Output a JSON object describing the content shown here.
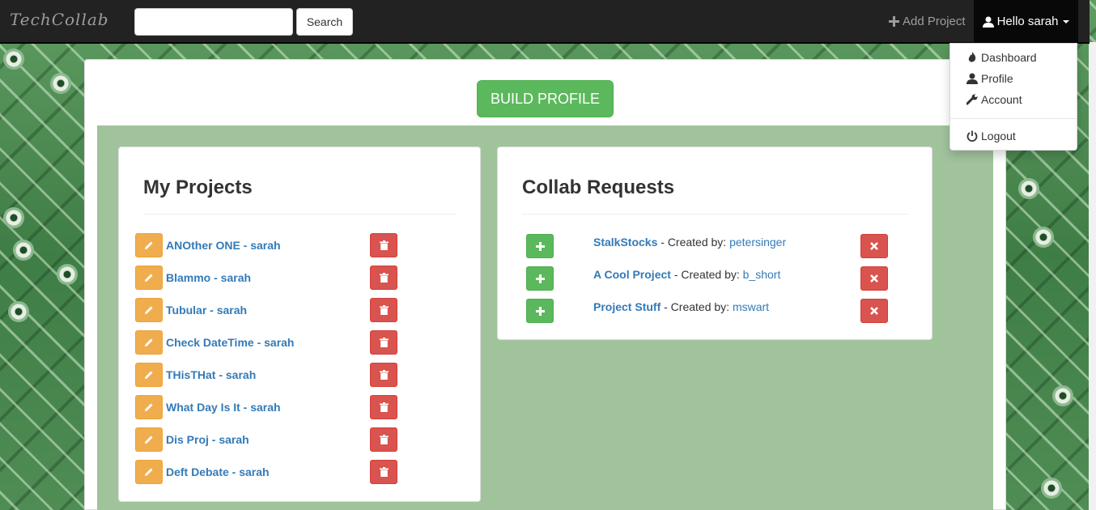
{
  "navbar": {
    "brand": "TechCollab",
    "search_placeholder": "",
    "search_button": "Search",
    "add_project": "Add Project",
    "user_greeting": "Hello sarah"
  },
  "user_menu": {
    "items": [
      {
        "label": "Dashboard",
        "icon": "fire-icon"
      },
      {
        "label": "Profile",
        "icon": "user-icon"
      },
      {
        "label": "Account",
        "icon": "wrench-icon"
      },
      {
        "label": "Logout",
        "icon": "power-icon"
      }
    ]
  },
  "main": {
    "build_profile": "BUILD PROFILE"
  },
  "my_projects": {
    "title": "My Projects",
    "items": [
      "ANOther ONE - sarah",
      "Blammo - sarah",
      "Tubular - sarah",
      "Check DateTime - sarah",
      "THisTHat - sarah",
      "What Day Is It - sarah",
      "Dis Proj - sarah",
      "Deft Debate - sarah"
    ]
  },
  "collab_requests": {
    "title": "Collab Requests",
    "created_by_label": " - Created by: ",
    "items": [
      {
        "project": "StalkStocks",
        "creator": "petersinger"
      },
      {
        "project": "A Cool Project",
        "creator": "b_short"
      },
      {
        "project": "Project Stuff",
        "creator": "mswart"
      }
    ]
  },
  "colors": {
    "navbar": "#222222",
    "success": "#5cb85c",
    "warning": "#f0ad4e",
    "danger": "#d9534f",
    "link": "#337ab7",
    "panel_area": "#a1c39c"
  }
}
